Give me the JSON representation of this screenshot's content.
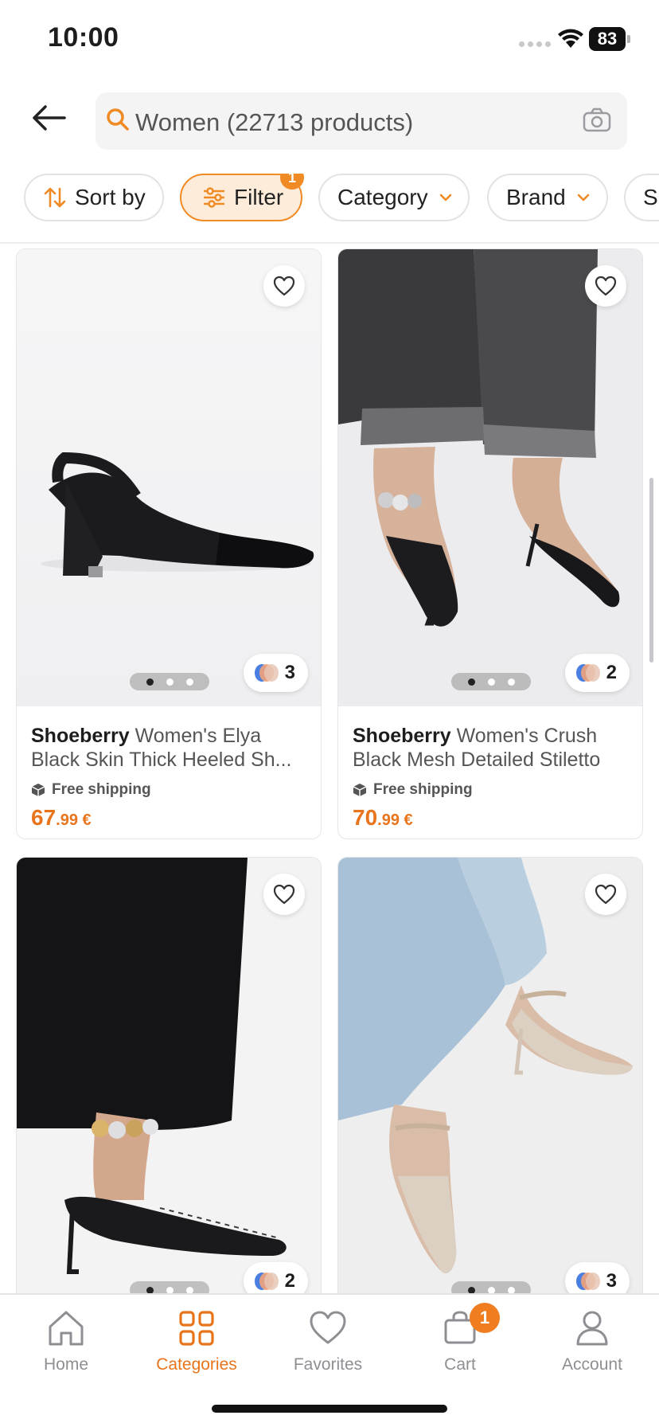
{
  "status_bar": {
    "time": "10:00",
    "battery": "83"
  },
  "header": {
    "back_icon": "arrow-left-icon",
    "search_text": "Women (22713 products)",
    "search_icon": "search-icon",
    "camera_icon": "camera-icon"
  },
  "chips": {
    "sort": "Sort by",
    "filter": "Filter",
    "filter_badge": "1",
    "category": "Category",
    "brand": "Brand",
    "size": "Si"
  },
  "colors": {
    "accent": "#e8741c",
    "badge": "#f08a24"
  },
  "products": [
    {
      "brand": "Shoeberry",
      "name_line1": "Women's Elya",
      "name_line2": "Black Skin Thick Heeled Sh...",
      "shipping": "Free shipping",
      "price_main": "67",
      "price_rest": ".99 €",
      "color_count": "3",
      "image_page": 1,
      "image_pages": 3
    },
    {
      "brand": "Shoeberry",
      "name_line1": "Women's Crush",
      "name_line2": "Black Mesh Detailed Stiletto",
      "shipping": "Free shipping",
      "price_main": "70",
      "price_rest": ".99 €",
      "color_count": "2",
      "image_page": 1,
      "image_pages": 3
    },
    {
      "color_count": "2",
      "image_page": 1,
      "image_pages": 3
    },
    {
      "color_count": "3",
      "image_page": 1,
      "image_pages": 3
    }
  ],
  "bottom_nav": {
    "home": "Home",
    "categories": "Categories",
    "favorites": "Favorites",
    "cart": "Cart",
    "cart_badge": "1",
    "account": "Account"
  }
}
